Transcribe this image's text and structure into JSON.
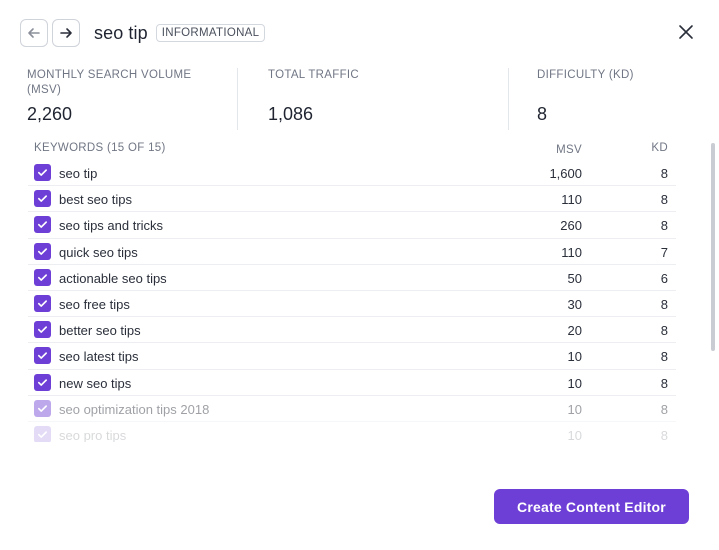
{
  "header": {
    "title": "seo tip",
    "intent_badge": "INFORMATIONAL",
    "back_icon": "arrow-left-icon",
    "forward_icon": "arrow-right-icon",
    "close_icon": "close-icon"
  },
  "stats": {
    "msv_label": "MONTHLY SEARCH VOLUME (MSV)",
    "msv_value": "2,260",
    "traffic_label": "TOTAL TRAFFIC",
    "traffic_value": "1,086",
    "kd_label": "DIFFICULTY (KD)",
    "kd_value": "8"
  },
  "keywords": {
    "header_label": "KEYWORDS (15 OF 15)",
    "col_msv": "MSV",
    "col_kd": "KD",
    "rows": [
      {
        "keyword": "seo tip",
        "msv": "1,600",
        "kd": "8",
        "checked": true
      },
      {
        "keyword": "best seo tips",
        "msv": "110",
        "kd": "8",
        "checked": true
      },
      {
        "keyword": "seo tips and tricks",
        "msv": "260",
        "kd": "8",
        "checked": true
      },
      {
        "keyword": "quick seo tips",
        "msv": "110",
        "kd": "7",
        "checked": true
      },
      {
        "keyword": "actionable seo tips",
        "msv": "50",
        "kd": "6",
        "checked": true
      },
      {
        "keyword": "seo free tips",
        "msv": "30",
        "kd": "8",
        "checked": true
      },
      {
        "keyword": "better seo tips",
        "msv": "20",
        "kd": "8",
        "checked": true
      },
      {
        "keyword": "seo latest tips",
        "msv": "10",
        "kd": "8",
        "checked": true
      },
      {
        "keyword": "new seo tips",
        "msv": "10",
        "kd": "8",
        "checked": true
      },
      {
        "keyword": "seo optimization tips 2018",
        "msv": "10",
        "kd": "8",
        "checked": true
      },
      {
        "keyword": "seo pro tips",
        "msv": "10",
        "kd": "8",
        "checked": true
      }
    ]
  },
  "footer": {
    "cta_label": "Create Content Editor"
  },
  "colors": {
    "accent": "#6e3fd6",
    "text": "#1f2430",
    "muted": "#707684"
  }
}
